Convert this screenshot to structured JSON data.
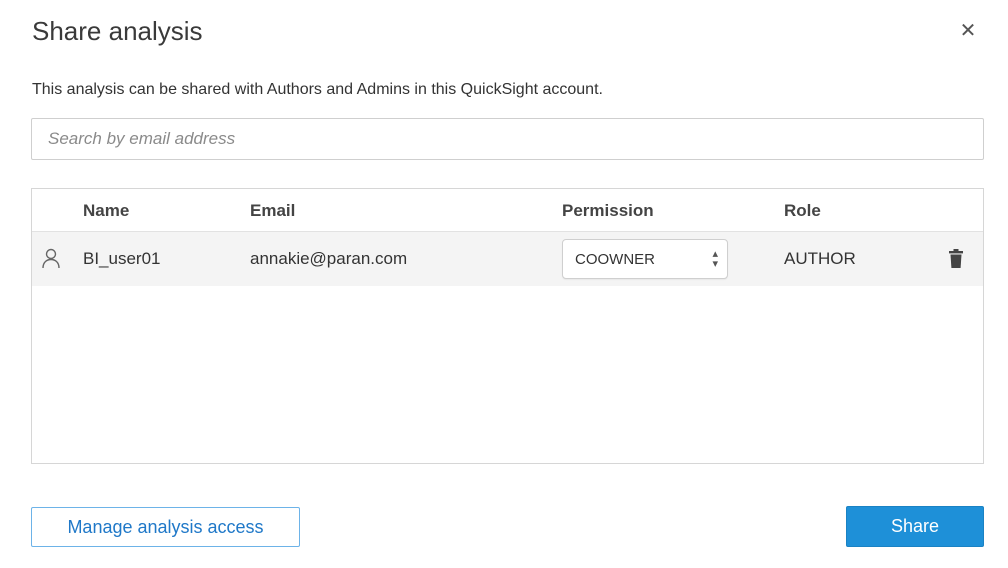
{
  "dialog": {
    "title": "Share analysis",
    "close_icon": "close-icon",
    "description": "This analysis can be shared with Authors and Admins in this QuickSight account.",
    "search": {
      "placeholder": "Search by email address",
      "value": ""
    }
  },
  "table": {
    "headers": {
      "name": "Name",
      "email": "Email",
      "permission": "Permission",
      "role": "Role"
    },
    "rows": [
      {
        "icon": "user-icon",
        "name": "BI_user01",
        "email": "annakie@paran.com",
        "permission": "COOWNER",
        "role": "AUTHOR",
        "delete_icon": "trash-icon"
      }
    ]
  },
  "footer": {
    "manage_label": "Manage analysis access",
    "share_label": "Share"
  },
  "colors": {
    "accent": "#1e90d8",
    "link": "#1f78c8",
    "row_bg": "#f4f4f4"
  }
}
